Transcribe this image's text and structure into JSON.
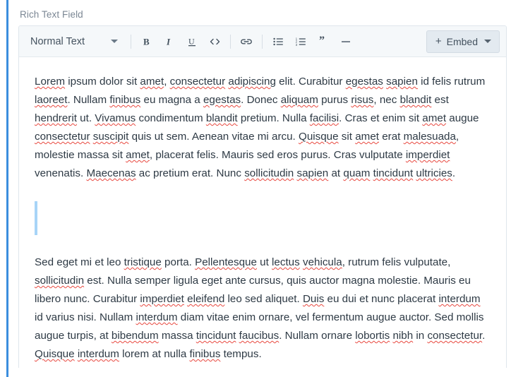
{
  "field": {
    "label": "Rich Text Field"
  },
  "toolbar": {
    "style_select": {
      "value": "Normal Text",
      "caret_icon": "chevron-down-icon"
    },
    "buttons": [
      {
        "name": "bold",
        "label": "B",
        "icon": "bold-icon"
      },
      {
        "name": "italic",
        "label": "I",
        "icon": "italic-icon"
      },
      {
        "name": "underline",
        "label": "U",
        "icon": "underline-icon"
      },
      {
        "name": "code",
        "label": "<>",
        "icon": "code-icon"
      },
      {
        "name": "link",
        "label": "",
        "icon": "link-icon"
      },
      {
        "name": "bulleted-list",
        "label": "",
        "icon": "bulleted-list-icon"
      },
      {
        "name": "numbered-list",
        "label": "",
        "icon": "numbered-list-icon"
      },
      {
        "name": "blockquote",
        "label": "",
        "icon": "quote-icon"
      },
      {
        "name": "horizontal-rule",
        "label": "",
        "icon": "horizontal-rule-icon"
      }
    ],
    "embed": {
      "plus": "+",
      "label": "Embed",
      "caret_icon": "chevron-down-icon"
    }
  },
  "content": {
    "paragraph_1": "Lorem ipsum dolor sit amet, consectetur adipiscing elit. Curabitur egestas sapien id felis rutrum laoreet. Nullam finibus eu magna a egestas. Donec aliquam purus risus, nec blandit est hendrerit ut. Vivamus condimentum blandit pretium. Nulla facilisi. Cras et enim sit amet augue consectetur suscipit quis ut sem. Aenean vitae mi arcu. Quisque sit amet erat malesuada, molestie massa sit amet, placerat felis. Mauris sed eros purus. Cras vulputate imperdiet venenatis. Maecenas ac pretium erat. Nunc sollicitudin sapien at quam tincidunt ultricies.",
    "blockquote_empty": "",
    "paragraph_2": "Sed eget mi et leo tristique porta. Pellentesque ut lectus vehicula, rutrum felis vulputate, sollicitudin est. Nulla semper ligula eget ante cursus, quis auctor magna molestie. Mauris eu libero nunc. Curabitur imperdiet eleifend leo sed aliquet. Duis eu dui et nunc placerat interdum id varius nisi. Nullam interdum diam vitae enim ornare, vel fermentum augue auctor. Sed mollis augue turpis, at bibendum massa tincidunt faucibus. Nullam ornare lobortis nibh in consectetur. Quisque interdum lorem at nulla finibus tempus.",
    "misspelled_words": [
      "amet",
      "consectetur",
      "adipiscing",
      "egestas",
      "sapien",
      "laoreet",
      "finibus",
      "aliquam",
      "risus",
      "blandit",
      "hendrerit",
      "Vivamus",
      "facilisi",
      "malesuada",
      "imperdiet",
      "Maecenas",
      "sollicitudin",
      "quam",
      "tincidunt",
      "ultricies",
      "tristique",
      "Pellentesque",
      "lectus",
      "vehicula",
      "interdum",
      "eleifend",
      "Duis",
      "bibendum",
      "faucibus",
      "lobortis",
      "nibh",
      "Quisque"
    ]
  },
  "colors": {
    "focus_bar": "#3b8ede",
    "blockquote_bar": "#a7d4f7",
    "toolbar_bg": "#f5f8fa",
    "label_text": "#7b8794",
    "body_text": "#2e3a45",
    "spellcheck_underline": "#e8483f"
  }
}
